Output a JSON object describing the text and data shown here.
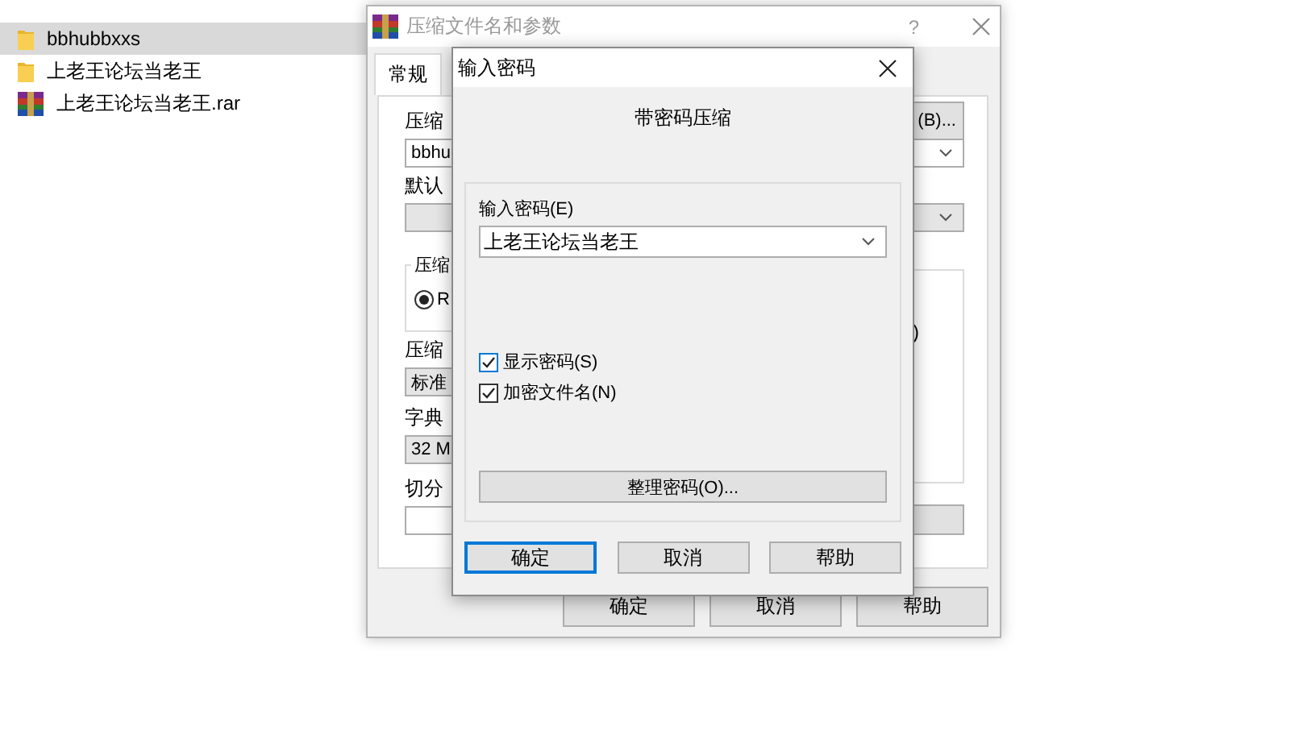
{
  "explorer": {
    "files": [
      {
        "name": "bbhubbxxs",
        "kind": "folder",
        "selected": true
      },
      {
        "name": "上老王论坛当老王",
        "kind": "folder",
        "selected": false
      },
      {
        "name": "上老王论坛当老王.rar",
        "kind": "archive",
        "selected": false
      }
    ]
  },
  "archive_window": {
    "title": "压缩文件名和参数",
    "help": "?",
    "tabs": [
      {
        "label": "常规",
        "selected": true
      }
    ],
    "archive_name_label": "压缩",
    "browse_button": "(B)...",
    "archive_name_value": "bbhu",
    "profile_label": "默认",
    "format_group_label": "压缩",
    "format_options": [
      {
        "label": "R",
        "selected": true
      }
    ],
    "options_group_text": ")",
    "method_label": "压缩",
    "method_value": "标准",
    "dictionary_label": "字典",
    "dictionary_value": "32 M",
    "split_label": "切分",
    "buttons": [
      "确定",
      "取消",
      "帮助"
    ]
  },
  "password_dialog": {
    "title": "输入密码",
    "heading": "带密码压缩",
    "password_label": "输入密码(E)",
    "password_value": "上老王论坛当老王",
    "options": [
      {
        "label": "显示密码(S)",
        "checked": true
      },
      {
        "label": "加密文件名(N)",
        "checked": true
      }
    ],
    "organize_button": "整理密码(O)...",
    "buttons": [
      {
        "label": "确定",
        "focused": true
      },
      {
        "label": "取消",
        "focused": false
      },
      {
        "label": "帮助",
        "focused": false
      }
    ]
  }
}
